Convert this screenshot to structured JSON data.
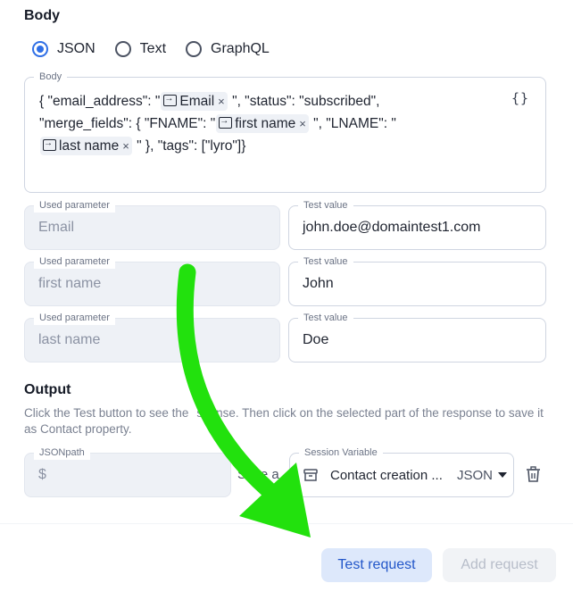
{
  "body_section": {
    "title": "Body",
    "radios": [
      {
        "label": "JSON",
        "selected": true
      },
      {
        "label": "Text",
        "selected": false
      },
      {
        "label": "GraphQL",
        "selected": false
      }
    ],
    "editor": {
      "legend": "Body",
      "format_icon": "{}",
      "seg": {
        "s1": "{  \"email_address\": \"",
        "t1": "Email",
        "s2": " \",  \"status\": \"subscribed\",",
        "s3": "\"merge_fields\": {    \"FNAME\": \"",
        "t2": "first name",
        "s4": " \",    \"LNAME\": \"",
        "t3": "last name",
        "s5": " \"  },  \"tags\": [\"lyro\"]}"
      },
      "remove_glyph": "×"
    },
    "params": [
      {
        "param_legend": "Used parameter",
        "param": "Email",
        "test_legend": "Test value",
        "test": "john.doe@domaintest1.com"
      },
      {
        "param_legend": "Used parameter",
        "param": "first name",
        "test_legend": "Test value",
        "test": "John"
      },
      {
        "param_legend": "Used parameter",
        "param": "last name",
        "test_legend": "Test value",
        "test": "Doe"
      }
    ]
  },
  "output_section": {
    "title": "Output",
    "hint_a": "Click the Test button to see the",
    "hint_b": "sponse. Then click on the selected part of the response to save it as Contact property.",
    "jsonpath_legend": "JSONpath",
    "jsonpath_value": "$",
    "save_as_partial": "Save a",
    "session_legend": "Session Variable",
    "session_value": "Contact creation ...",
    "session_type": "JSON"
  },
  "footer": {
    "test_button": "Test request",
    "add_button": "Add request"
  },
  "colors": {
    "accent": "#2f6fe6",
    "arrow": "#22e10d"
  }
}
